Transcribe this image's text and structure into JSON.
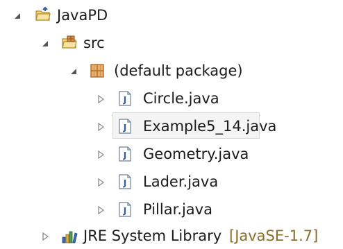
{
  "tree": {
    "project": {
      "label": "JavaPD",
      "icon": "project-folder-icon",
      "expanded": true
    },
    "src": {
      "label": "src",
      "icon": "source-folder-icon",
      "expanded": true
    },
    "package": {
      "label": "(default package)",
      "icon": "package-icon",
      "expanded": true
    },
    "files": [
      {
        "label": "Circle.java",
        "icon": "java-file-icon",
        "selected": false
      },
      {
        "label": "Example5_14.java",
        "icon": "java-file-icon",
        "selected": true
      },
      {
        "label": "Geometry.java",
        "icon": "java-file-icon",
        "selected": false
      },
      {
        "label": "Lader.java",
        "icon": "java-file-icon",
        "selected": false
      },
      {
        "label": "Pillar.java",
        "icon": "java-file-icon",
        "selected": false
      }
    ],
    "library": {
      "label": "JRE System Library",
      "suffix": "[JavaSE-1.7]",
      "icon": "library-icon",
      "expanded": false
    }
  },
  "colors": {
    "java_icon_blue": "#2f5aa8",
    "folder_yellow": "#e8c35a",
    "package_brown": "#b06a2a",
    "suffix_brown": "#8a6d2a"
  }
}
